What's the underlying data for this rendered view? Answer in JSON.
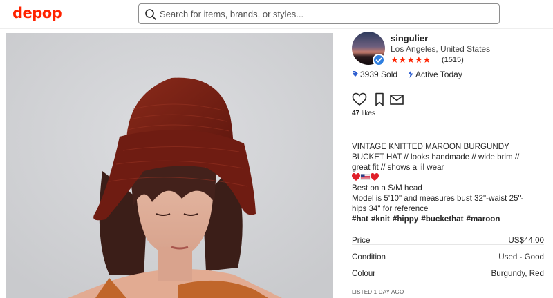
{
  "header": {
    "logo": "depop",
    "search_placeholder": "Search for items, brands, or styles..."
  },
  "seller": {
    "username": "singulier",
    "location": "Los Angeles, United States",
    "rating_stars": 5,
    "review_count": "(1515)"
  },
  "stats": {
    "sold": "3939 Sold",
    "active": "Active Today"
  },
  "likes": {
    "count": "47",
    "label": "likes"
  },
  "description": {
    "lines": [
      "VINTAGE KNITTED MAROON BURGUNDY",
      "BUCKET HAT // looks handmade // wide brim //",
      "great fit // shows a lil wear"
    ],
    "line_size": "Best on a S/M head",
    "line_model_1": "Model is 5'10\" and measures bust 32\"-waist 25\"-",
    "line_model_2": "hips 34\" for reference",
    "tags": [
      "#hat",
      "#knit",
      "#hippy",
      "#buckethat",
      "#maroon"
    ]
  },
  "details": [
    {
      "label": "Price",
      "value": "US$44.00"
    },
    {
      "label": "Condition",
      "value": "Used - Good"
    },
    {
      "label": "Colour",
      "value": "Burgundy, Red"
    }
  ],
  "listed": "LISTED 1 DAY AGO",
  "colors": {
    "brand": "#ff2300",
    "hat": "#7a1f14",
    "verified": "#2f7fe0"
  }
}
